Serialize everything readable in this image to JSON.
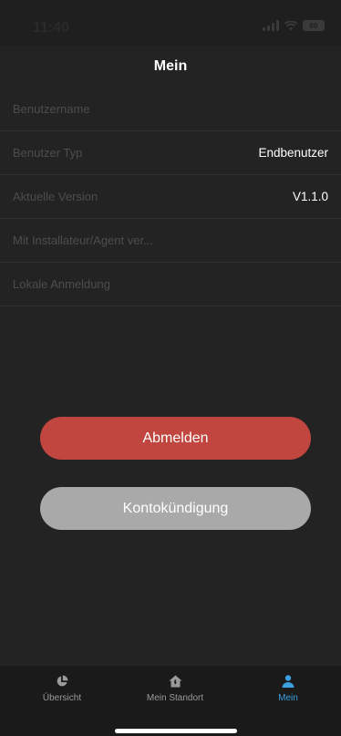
{
  "status_bar": {
    "time": "11:40",
    "battery": "60"
  },
  "header": {
    "title": "Mein"
  },
  "rows": [
    {
      "label": "Benutzername",
      "value": ""
    },
    {
      "label": "Benutzer Typ",
      "value": "Endbenutzer"
    },
    {
      "label": "Aktuelle Version",
      "value": "V1.1.0"
    },
    {
      "label": "Mit Installateur/Agent ver...",
      "value": ""
    },
    {
      "label": "Lokale Anmeldung",
      "value": ""
    }
  ],
  "buttons": {
    "logout": "Abmelden",
    "cancel_account": "Kontokündigung"
  },
  "tab_bar": {
    "tabs": [
      {
        "label": "Übersicht",
        "icon": "pie-chart-icon"
      },
      {
        "label": "Mein Standort",
        "icon": "home-icon"
      },
      {
        "label": "Mein",
        "icon": "person-icon"
      }
    ],
    "active_index": 2
  },
  "colors": {
    "accent": "#3aa0e0",
    "logout": "#c0463f",
    "cancel": "#a9a9a9"
  }
}
